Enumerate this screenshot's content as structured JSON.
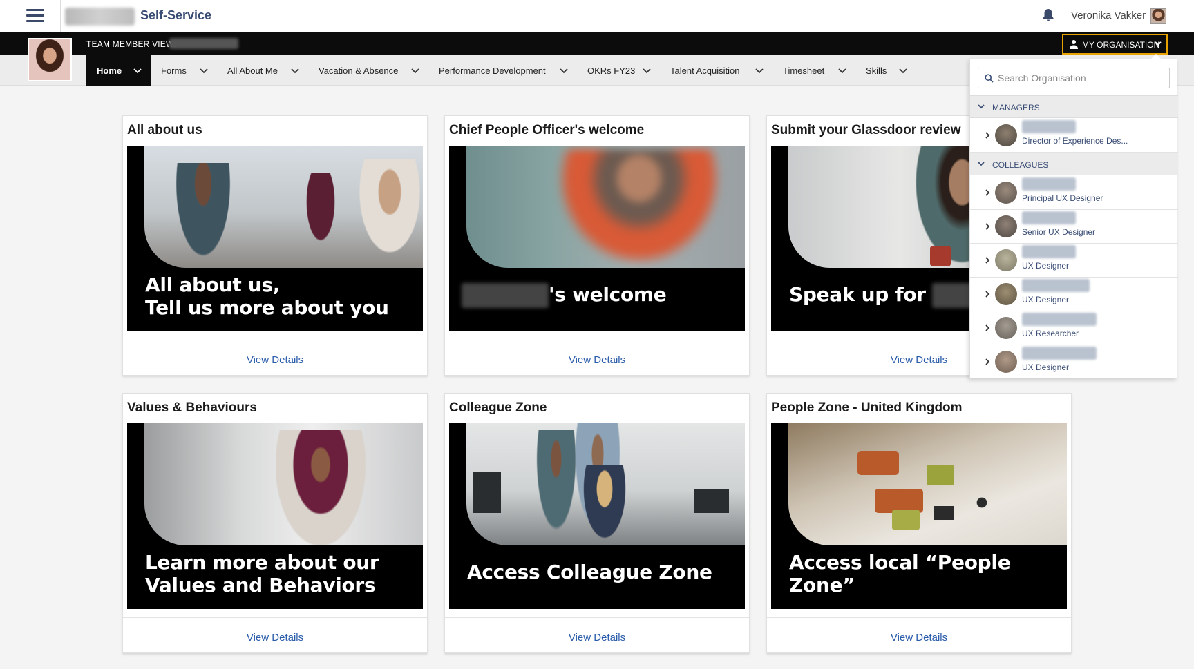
{
  "app": {
    "title": "Self-Service"
  },
  "user": {
    "name": "Veronika Vakker"
  },
  "teambar": {
    "label": "TEAM MEMBER VIEW:",
    "org_button": "MY ORGANISATION"
  },
  "nav": {
    "items": [
      {
        "label": "Home"
      },
      {
        "label": "Forms"
      },
      {
        "label": "All About Me"
      },
      {
        "label": "Vacation & Absence"
      },
      {
        "label": "Performance Development"
      },
      {
        "label": "OKRs FY23"
      },
      {
        "label": "Talent Acquisition"
      },
      {
        "label": "Timesheet"
      },
      {
        "label": "Skills"
      }
    ]
  },
  "cards": [
    {
      "title": "All about us",
      "overlay_line1": "All about us,",
      "overlay_line2": "Tell us more about you",
      "link": "View Details"
    },
    {
      "title": "Chief People Officer's welcome",
      "overlay": "'s welcome",
      "link": "View Details"
    },
    {
      "title": "Submit your Glassdoor review",
      "overlay": "Speak up for",
      "link": "View Details"
    },
    {
      "title": "Values & Behaviours",
      "overlay_line1": "Learn more about our",
      "overlay_line2": "Values and Behaviors",
      "link": "View Details"
    },
    {
      "title": "Colleague Zone",
      "overlay": "Access Colleague Zone",
      "link": "View Details"
    },
    {
      "title": "People Zone - United Kingdom",
      "overlay_line1": "Access local “People",
      "overlay_line2": "Zone”",
      "link": "View Details"
    }
  ],
  "org_panel": {
    "search_placeholder": "Search Organisation",
    "managers_label": "MANAGERS",
    "colleagues_label": "COLLEAGUES",
    "managers": [
      {
        "role": "Director of Experience Des..."
      }
    ],
    "colleagues": [
      {
        "role": "Principal UX Designer"
      },
      {
        "role": "Senior UX Designer"
      },
      {
        "role": "UX Designer"
      },
      {
        "role": "UX Designer"
      },
      {
        "role": "UX Researcher"
      },
      {
        "role": "UX Designer"
      }
    ]
  },
  "icons": {
    "menu": "hamburger-menu-icon",
    "notifications": "bell-icon",
    "search": "search-icon",
    "expand": "chevron-right-icon",
    "collapse": "chevron-down-icon",
    "person": "person-icon"
  },
  "colors": {
    "brand_text": "#3a4d74",
    "link": "#2a5caa",
    "highlight": "#e8a300",
    "bar": "#0c0c0c"
  }
}
